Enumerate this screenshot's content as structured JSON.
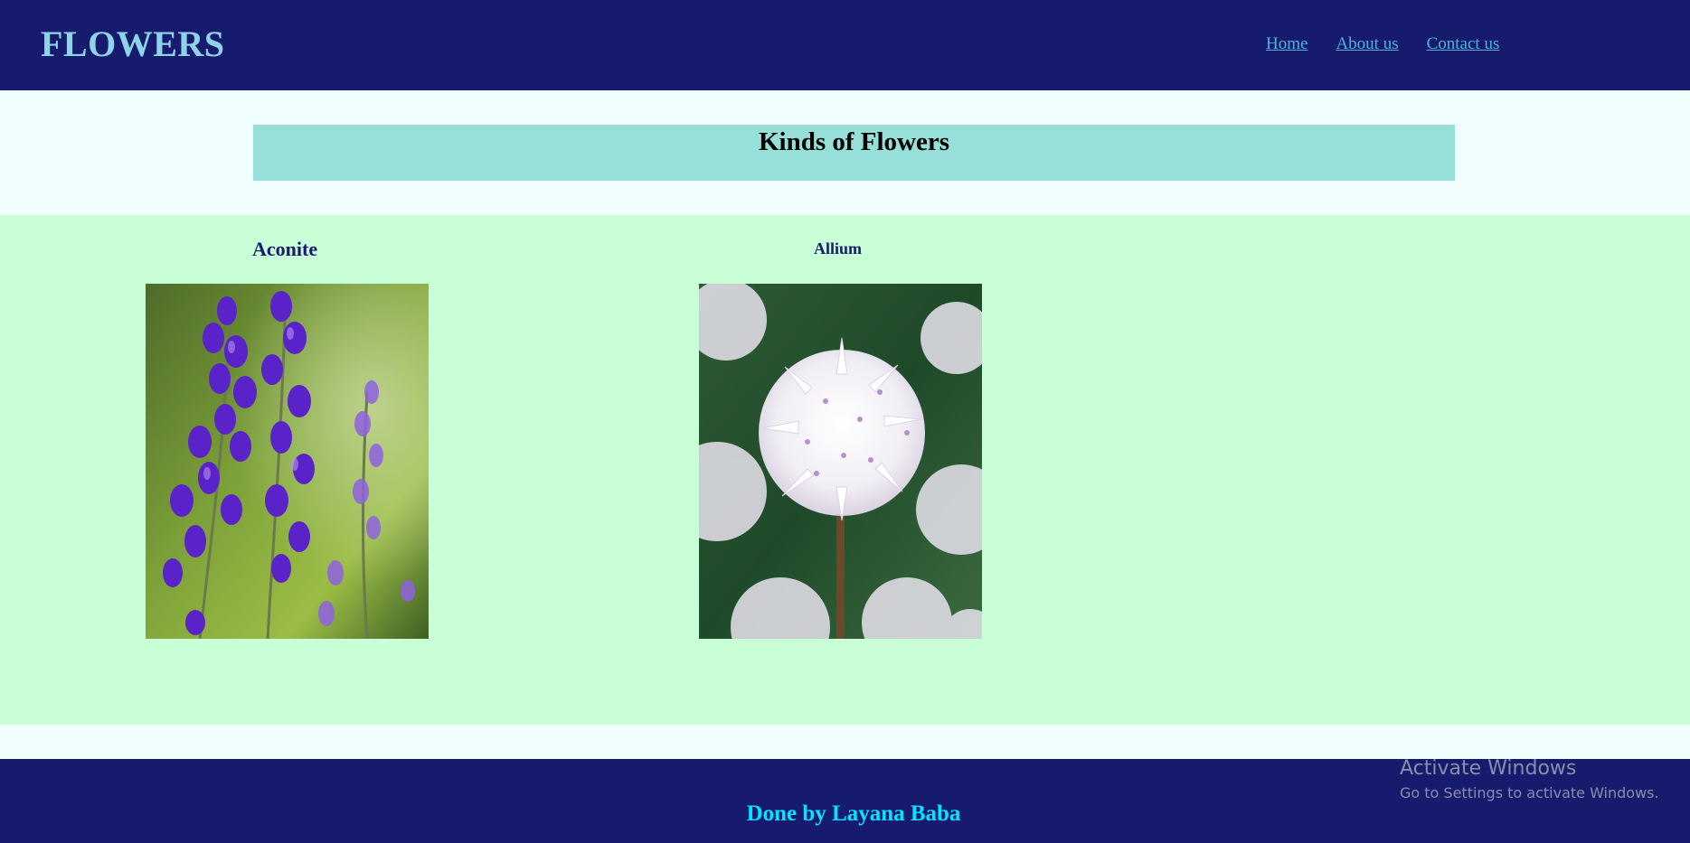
{
  "header": {
    "brand": "FLOWERS",
    "nav": [
      "Home",
      "About us",
      "Contact us"
    ]
  },
  "main": {
    "title": "Kinds of Flowers",
    "flowers": [
      {
        "name": "Aconite"
      },
      {
        "name": "Allium"
      }
    ]
  },
  "footer": {
    "credit": "Done by Layana Baba"
  },
  "watermark": {
    "title": "Activate Windows",
    "subtitle": "Go to Settings to activate Windows."
  },
  "colors": {
    "header_bg": "#161b6e",
    "brand": "#8fd3e8",
    "nav_link": "#4fb4d8",
    "title_band": "#97e0d9",
    "gallery_bg": "#c8ffd7",
    "footer_text": "#00e5ff"
  }
}
